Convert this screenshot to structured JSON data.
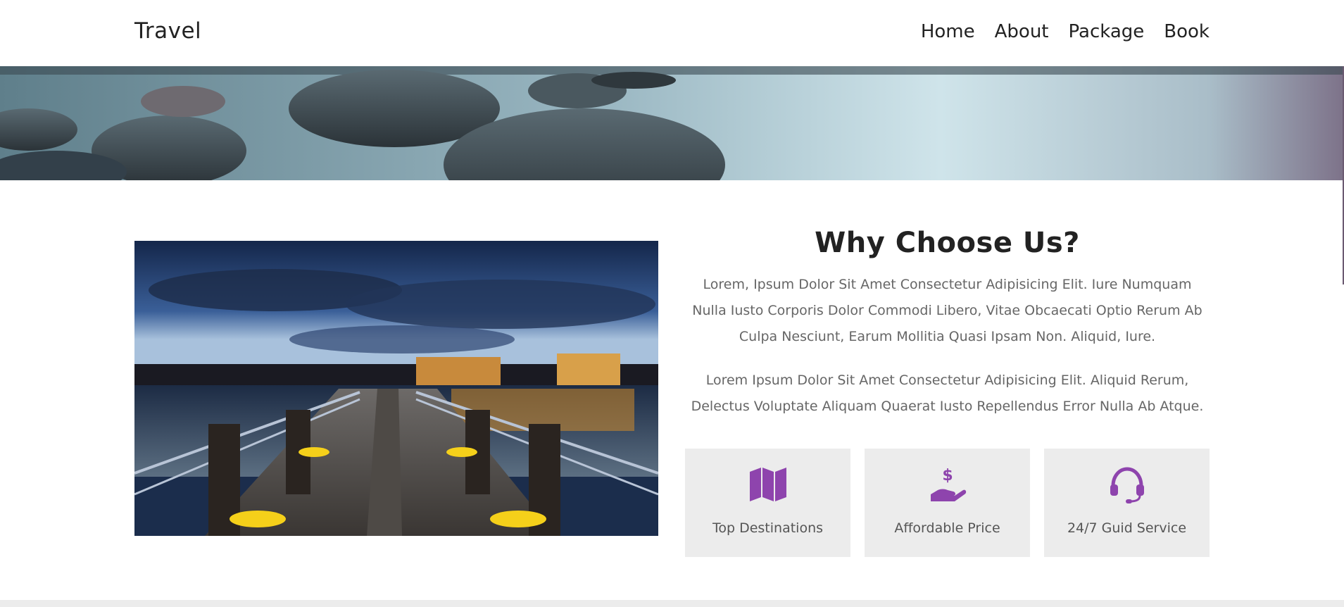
{
  "header": {
    "brand": "Travel",
    "nav": [
      "Home",
      "About",
      "Package",
      "Book"
    ]
  },
  "why": {
    "title": "Why Choose Us?",
    "paragraph1": "Lorem, Ipsum Dolor Sit Amet Consectetur Adipisicing Elit. Iure Numquam Nulla Iusto Corporis Dolor Commodi Libero, Vitae Obcaecati Optio Rerum Ab Culpa Nesciunt, Earum Mollitia Quasi Ipsam Non. Aliquid, Iure.",
    "paragraph2": "Lorem Ipsum Dolor Sit Amet Consectetur Adipisicing Elit. Aliquid Rerum, Delectus Voluptate Aliquam Quaerat Iusto Repellendus Error Nulla Ab Atque."
  },
  "features": [
    {
      "label": "Top Destinations",
      "icon": "map-icon"
    },
    {
      "label": "Affordable Price",
      "icon": "hand-dollar-icon"
    },
    {
      "label": "24/7 Guid Service",
      "icon": "headset-icon"
    }
  ],
  "colors": {
    "accent": "#8e44ad",
    "feature_bg": "#ececec",
    "text_muted": "#666666"
  }
}
